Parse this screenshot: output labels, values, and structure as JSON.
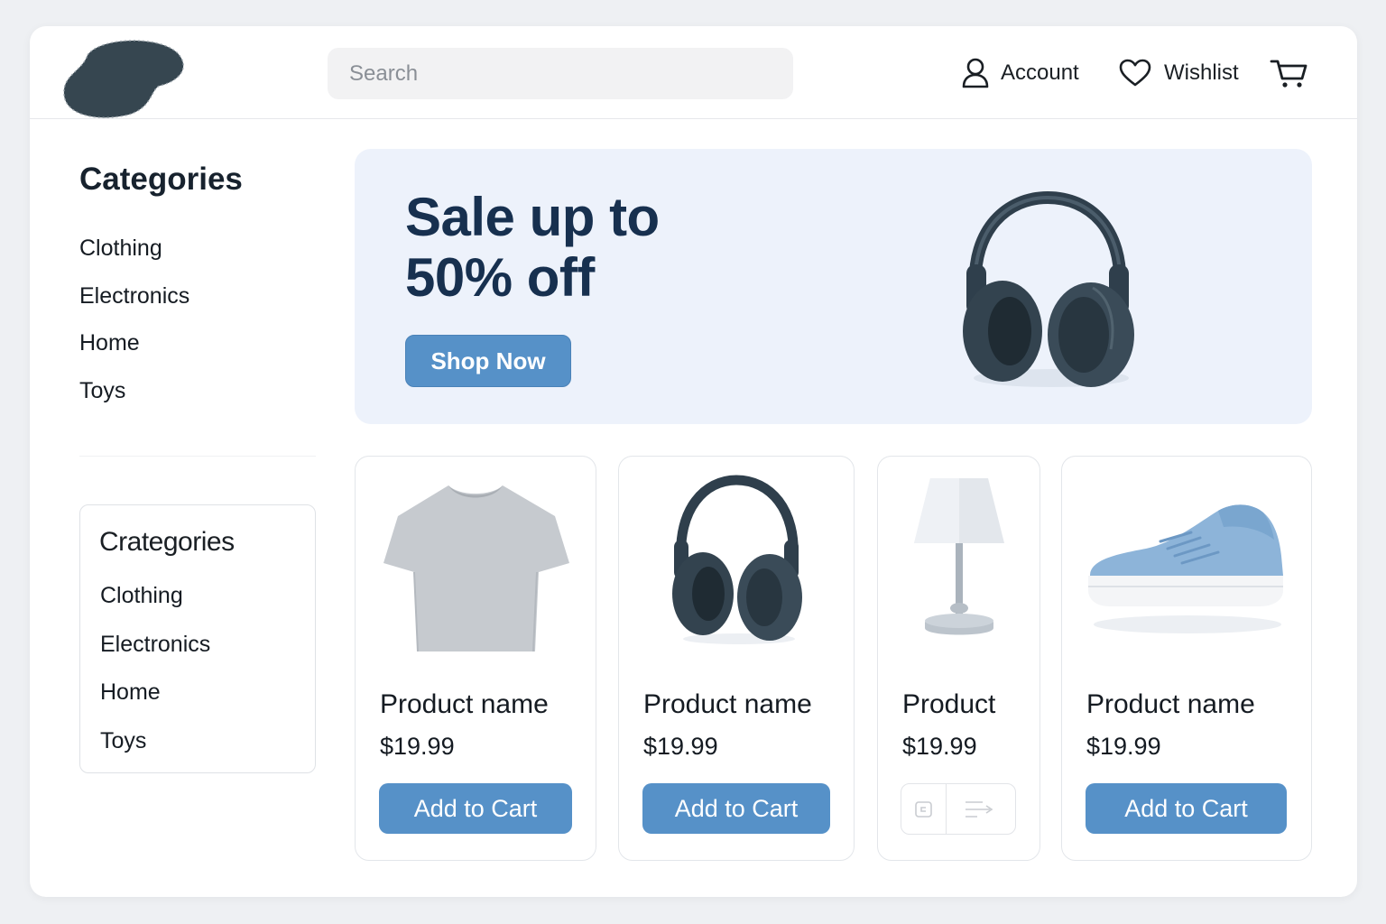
{
  "header": {
    "search_placeholder": "Search",
    "account_label": "Account",
    "wishlist_label": "Wishlist"
  },
  "sidebar": {
    "title": "Categories",
    "items": [
      "Clothing",
      "Electronics",
      "Home",
      "Toys"
    ]
  },
  "sidebar_card": {
    "title": "Crategories",
    "items": [
      "Clothing",
      "Electronics",
      "Home",
      "Toys"
    ]
  },
  "banner": {
    "title_line1": "Sale up to",
    "title_line2": "50% off",
    "button_label": "Shop Now",
    "image_icon": "headphones-icon"
  },
  "products": [
    {
      "name": "Product name",
      "price": "$19.99",
      "button_label": "Add to Cart",
      "image_icon": "tshirt-icon"
    },
    {
      "name": "Product name",
      "price": "$19.99",
      "button_label": "Add to Cart",
      "image_icon": "headphones-icon"
    },
    {
      "name": "Product",
      "price": "$19.99",
      "button_label": "",
      "image_icon": "lamp-icon"
    },
    {
      "name": "Product name",
      "price": "$19.99",
      "button_label": "Add to Cart",
      "image_icon": "sneaker-icon"
    }
  ],
  "colors": {
    "accent": "#5691c8",
    "banner_bg": "#edf2fb",
    "banner_title": "#17304f",
    "logo": "#364650"
  }
}
